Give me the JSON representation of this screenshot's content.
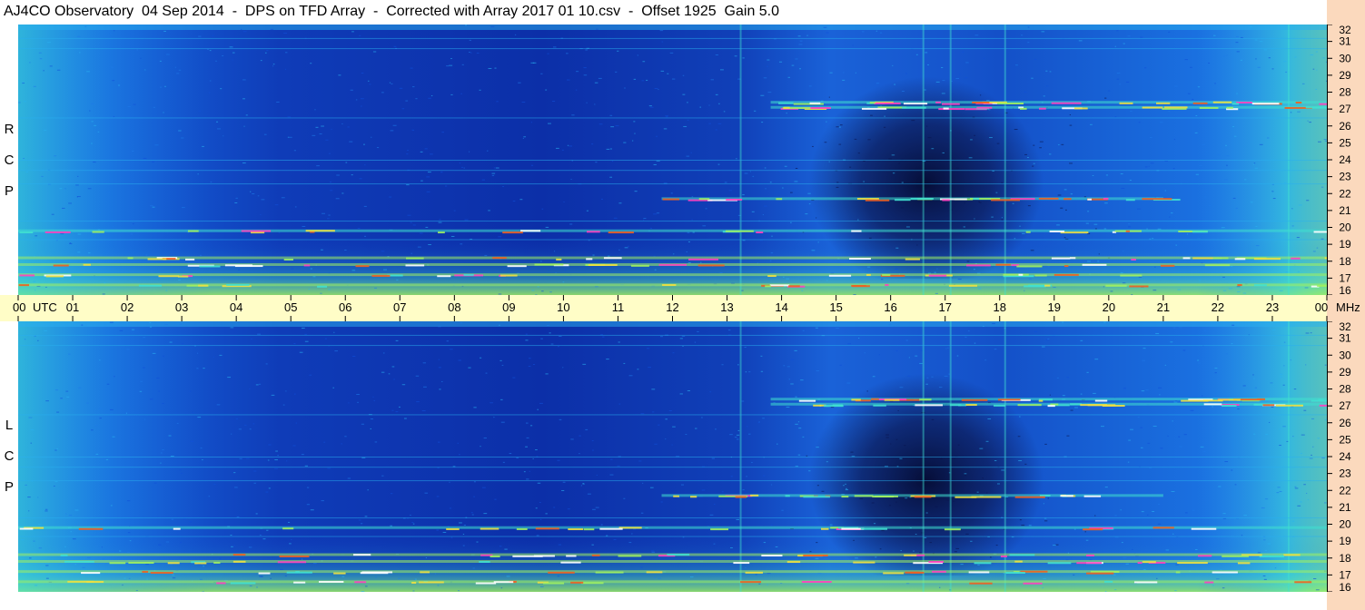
{
  "title": "AJ4CO Observatory  04 Sep 2014  -  DPS on TFD Array  -  Corrected with Array 2017 01 10.csv  -  Offset 1925  Gain 5.0",
  "polarizations": {
    "top": [
      "R",
      "C",
      "P"
    ],
    "bottom": [
      "L",
      "C",
      "P"
    ]
  },
  "chart_data": {
    "type": "heatmap",
    "title": "AJ4CO Observatory  04 Sep 2014  -  DPS on TFD Array  -  Corrected with Array 2017 01 10.csv  -  Offset 1925  Gain 5.0",
    "x_axis": {
      "unit": "UTC",
      "ticks": [
        "00",
        "01",
        "02",
        "03",
        "04",
        "05",
        "06",
        "07",
        "08",
        "09",
        "10",
        "11",
        "12",
        "13",
        "14",
        "15",
        "16",
        "17",
        "18",
        "19",
        "20",
        "21",
        "22",
        "23",
        "00"
      ],
      "range_hours": [
        0,
        24
      ]
    },
    "y_axis": {
      "unit": "MHz",
      "ticks": [
        16,
        17,
        18,
        19,
        20,
        21,
        22,
        23,
        24,
        25,
        26,
        27,
        28,
        29,
        30,
        31,
        32
      ],
      "range_mhz": [
        16,
        32
      ]
    },
    "panels": [
      {
        "name": "RCP",
        "label": [
          "R",
          "C",
          "P"
        ],
        "interference_bands_mhz": [
          16.6,
          17.2,
          17.8,
          18.2,
          19.8,
          21.7,
          27.1,
          27.4
        ],
        "dark_region": {
          "utc_hours": [
            15.5,
            17.8
          ],
          "mhz": [
            17.5,
            29
          ]
        },
        "broadband_spikes_utc": [
          13.25,
          16.6,
          17.1,
          18.1,
          23.3
        ]
      },
      {
        "name": "LCP",
        "label": [
          "L",
          "C",
          "P"
        ],
        "interference_bands_mhz": [
          16.6,
          17.2,
          17.8,
          18.2,
          19.8,
          21.7,
          27.1,
          27.4
        ],
        "dark_region": {
          "utc_hours": [
            15.5,
            17.8
          ],
          "mhz": [
            17.5,
            29
          ]
        },
        "broadband_spikes_utc": [
          13.25,
          16.6,
          17.1,
          18.1,
          23.3
        ]
      }
    ],
    "colormap": [
      "#0a1650",
      "#0a2a9a",
      "#1050d8",
      "#1e7ae8",
      "#2ab0f0",
      "#40e0d0",
      "#a0f060",
      "#f0e040",
      "#f06020",
      "#ff40c0",
      "#ffffff"
    ],
    "utc_label": "UTC",
    "mhz_label": "MHz"
  }
}
